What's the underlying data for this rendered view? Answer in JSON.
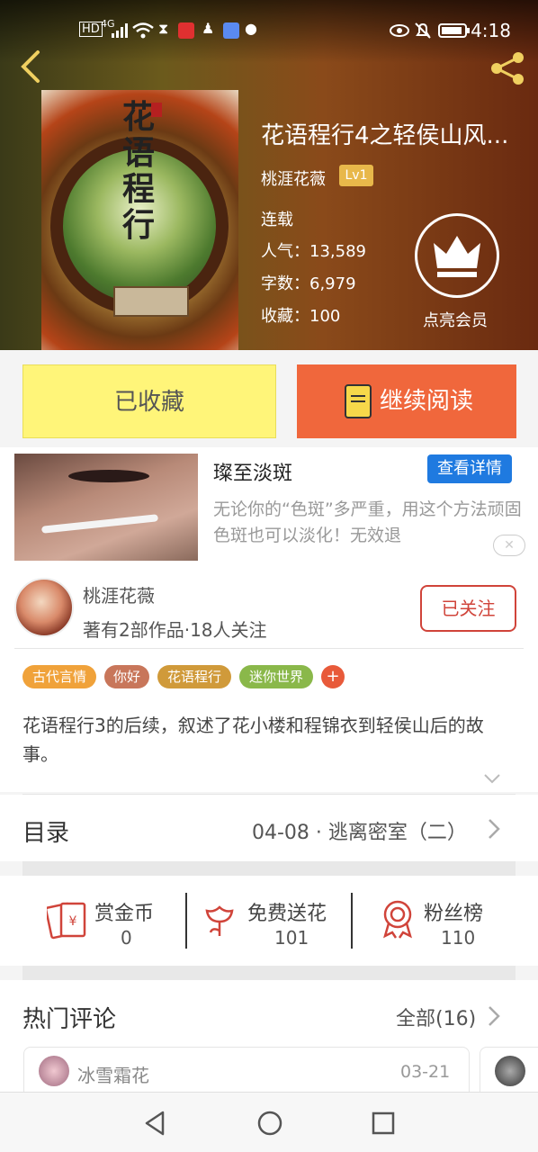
{
  "status": {
    "time": "4:18",
    "net": "HD",
    "signal": "4G"
  },
  "book": {
    "title": "花语程行4之轻侯山风...",
    "cover_title": "花语程行",
    "author": "桃涯花薇",
    "level": "Lv1",
    "state": "连载",
    "popularity": "人气：13,589",
    "words": "字数：6,979",
    "favorites": "收藏：100",
    "vip_label": "点亮会员"
  },
  "actions": {
    "fav_label": "已收藏",
    "read_label": "继续阅读"
  },
  "ad": {
    "title": "璨至淡斑",
    "detail_label": "查看详情",
    "desc": "无论你的“色斑”多严重，用这个方法顽固色斑也可以淡化！无效退",
    "close": "✕"
  },
  "author": {
    "name": "桃涯花薇",
    "stats": "著有2部作品·18人关注",
    "follow_label": "已关注"
  },
  "tags": [
    {
      "label": "古代言情",
      "color": "#f0a23a"
    },
    {
      "label": "你好",
      "color": "#c8765a"
    },
    {
      "label": "花语程行",
      "color": "#d09a3a"
    },
    {
      "label": "迷你世界",
      "color": "#8ab84a"
    }
  ],
  "tag_add": "+",
  "synopsis": "花语程行3的后续，叙述了花小楼和程锦衣到轻侯山后的故事。",
  "toc": {
    "label": "目录",
    "latest": "04-08 · 逃离密室（二）"
  },
  "rewards": [
    {
      "label": "赏金币",
      "value": "0",
      "icon": "red-envelope-icon"
    },
    {
      "label": "免费送花",
      "value": "101",
      "icon": "flower-icon"
    },
    {
      "label": "粉丝榜",
      "value": "110",
      "icon": "medal-icon"
    }
  ],
  "comments": {
    "title": "热门评论",
    "all_label": "全部(16)",
    "first_user": "冰雪霜花",
    "first_date": "03-21"
  },
  "colors": {
    "accent": "#f0673c",
    "fav_bg": "#fff579",
    "ad_button": "#1f7ae0",
    "follow": "#d0443a"
  }
}
